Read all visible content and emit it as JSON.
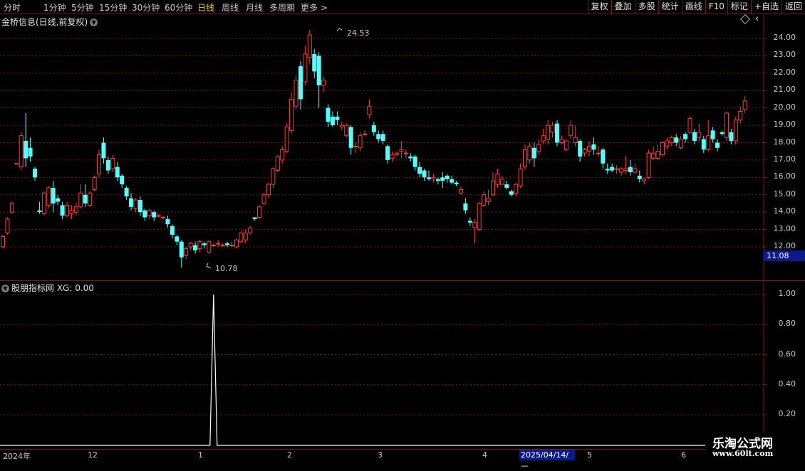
{
  "toolbar": {
    "periods": [
      "分时",
      "1分钟",
      "5分钟",
      "15分钟",
      "30分钟",
      "60分钟",
      "日线",
      "周线",
      "月线",
      "多周期",
      "更多 >"
    ],
    "active": "日线",
    "right_tabs": [
      "复权",
      "叠加",
      "多股",
      "统计",
      "画线",
      "F10",
      "标记",
      "+自选",
      "返回"
    ]
  },
  "chart_title": "金桥信息(日线,前复权)",
  "indicator_title": "股朋指标网  XG: 0.00",
  "price_axis": [
    "24.00",
    "23.00",
    "22.00",
    "21.00",
    "20.00",
    "19.00",
    "18.00",
    "17.00",
    "16.00",
    "15.00",
    "14.00",
    "13.00",
    "12.00"
  ],
  "last_price": "11.08",
  "high_annotation": "24.53",
  "low_annotation": "10.78",
  "indicator_axis": [
    "1.00",
    "0.80",
    "0.60",
    "0.40",
    "0.20"
  ],
  "date_axis": [
    "2024年",
    "12",
    "1",
    "2",
    "3",
    "4",
    "5",
    "6"
  ],
  "date_highlight": "2025/04/14/—",
  "watermark": {
    "title": "乐淘公式网",
    "url": "www.60lt.com"
  },
  "colors": {
    "up": "#ff3c3c",
    "down": "#54ffff",
    "grid": "#7a1a1a",
    "active": "#e6d23c",
    "highlight": "#0b1a8a"
  },
  "chart_data": {
    "type": "candlestick",
    "price_range": [
      11.0,
      24.8
    ],
    "candles": [
      [
        12.0,
        12.6,
        11.9,
        12.7
      ],
      [
        12.8,
        13.6,
        12.7,
        13.7
      ],
      [
        14.0,
        14.5,
        13.9,
        14.6
      ],
      [
        16.8,
        16.8,
        16.8,
        16.8
      ],
      [
        16.6,
        18.4,
        16.4,
        18.6
      ],
      [
        18.1,
        17.1,
        16.6,
        19.7
      ],
      [
        17.7,
        17.2,
        16.9,
        18.3
      ],
      [
        16.5,
        16.0,
        15.8,
        16.6
      ],
      [
        14.1,
        14.0,
        13.9,
        14.6
      ],
      [
        13.9,
        15.1,
        13.8,
        15.2
      ],
      [
        14.4,
        15.4,
        14.2,
        15.5
      ],
      [
        15.4,
        14.5,
        14.0,
        15.8
      ],
      [
        14.8,
        14.6,
        14.4,
        15.0
      ],
      [
        14.4,
        13.8,
        13.6,
        14.6
      ],
      [
        13.8,
        14.4,
        13.7,
        14.6
      ],
      [
        13.9,
        14.1,
        13.6,
        14.4
      ],
      [
        14.0,
        14.3,
        13.8,
        14.5
      ],
      [
        14.3,
        15.1,
        14.2,
        15.6
      ],
      [
        15.0,
        14.5,
        14.3,
        15.6
      ],
      [
        14.4,
        15.1,
        14.3,
        15.2
      ],
      [
        15.3,
        16.0,
        15.2,
        16.1
      ],
      [
        16.2,
        17.3,
        16.0,
        17.6
      ],
      [
        18.0,
        17.1,
        16.8,
        18.3
      ],
      [
        17.0,
        16.4,
        16.2,
        17.2
      ],
      [
        16.5,
        17.1,
        16.3,
        17.3
      ],
      [
        16.6,
        16.0,
        15.8,
        16.9
      ],
      [
        16.1,
        15.6,
        15.4,
        16.2
      ],
      [
        15.4,
        14.9,
        14.7,
        15.5
      ],
      [
        14.8,
        14.3,
        14.1,
        15.1
      ],
      [
        14.2,
        14.7,
        14.0,
        14.8
      ],
      [
        14.7,
        14.0,
        13.8,
        14.9
      ],
      [
        14.1,
        13.7,
        13.5,
        14.2
      ],
      [
        13.8,
        14.1,
        13.6,
        14.2
      ],
      [
        14.0,
        13.7,
        13.5,
        14.1
      ],
      [
        13.8,
        13.8,
        13.7,
        13.9
      ],
      [
        13.7,
        13.7,
        13.6,
        13.8
      ],
      [
        13.6,
        13.3,
        13.1,
        13.8
      ],
      [
        13.2,
        12.7,
        12.5,
        13.3
      ],
      [
        12.6,
        12.3,
        12.1,
        12.7
      ],
      [
        12.3,
        11.4,
        10.8,
        12.4
      ],
      [
        11.5,
        11.9,
        11.3,
        12.0
      ],
      [
        12.0,
        12.2,
        11.8,
        12.3
      ],
      [
        12.1,
        11.8,
        11.6,
        12.3
      ],
      [
        11.9,
        12.3,
        11.7,
        12.4
      ],
      [
        12.2,
        12.1,
        11.9,
        12.3
      ],
      [
        11.7,
        12.3,
        11.6,
        12.4
      ],
      [
        12.1,
        12.1,
        12.0,
        12.2
      ],
      [
        12.2,
        12.2,
        12.0,
        12.4
      ],
      [
        12.1,
        12.1,
        12.0,
        12.2
      ],
      [
        12.2,
        12.1,
        12.0,
        12.3
      ],
      [
        12.1,
        12.1,
        12.0,
        12.3
      ],
      [
        12.0,
        12.4,
        11.9,
        12.5
      ],
      [
        12.3,
        12.8,
        12.2,
        12.9
      ],
      [
        12.4,
        12.8,
        12.2,
        13.0
      ],
      [
        12.8,
        13.1,
        12.7,
        13.2
      ],
      [
        13.7,
        13.6,
        13.5,
        13.7
      ],
      [
        13.7,
        14.3,
        13.6,
        14.4
      ],
      [
        14.5,
        15.0,
        14.4,
        15.1
      ],
      [
        15.0,
        15.6,
        14.8,
        15.7
      ],
      [
        15.6,
        16.5,
        15.4,
        16.6
      ],
      [
        16.4,
        17.2,
        16.3,
        17.3
      ],
      [
        17.0,
        17.6,
        16.8,
        17.8
      ],
      [
        17.5,
        18.9,
        17.4,
        19.1
      ],
      [
        18.7,
        20.5,
        18.5,
        20.9
      ],
      [
        20.1,
        21.6,
        19.9,
        21.9
      ],
      [
        22.4,
        20.5,
        19.9,
        22.7
      ],
      [
        21.5,
        23.1,
        21.3,
        23.6
      ],
      [
        22.9,
        24.2,
        22.5,
        24.5
      ],
      [
        23.1,
        22.1,
        21.7,
        23.4
      ],
      [
        23.0,
        21.3,
        20.0,
        23.2
      ],
      [
        21.3,
        21.6,
        20.9,
        21.8
      ],
      [
        20.0,
        19.2,
        18.9,
        20.2
      ],
      [
        19.5,
        19.0,
        18.9,
        19.8
      ],
      [
        19.5,
        19.3,
        19.0,
        19.8
      ],
      [
        18.9,
        19.0,
        18.7,
        19.2
      ],
      [
        18.4,
        19.0,
        18.3,
        19.1
      ],
      [
        18.9,
        17.7,
        17.3,
        19.0
      ],
      [
        17.8,
        17.8,
        17.4,
        18.0
      ],
      [
        17.7,
        18.4,
        17.5,
        18.6
      ],
      [
        18.5,
        18.5,
        18.4,
        18.7
      ],
      [
        19.6,
        20.1,
        19.4,
        20.5
      ],
      [
        19.0,
        18.6,
        18.4,
        19.2
      ],
      [
        18.5,
        18.2,
        18.0,
        18.7
      ],
      [
        18.5,
        18.1,
        17.9,
        18.7
      ],
      [
        17.8,
        17.0,
        16.8,
        17.9
      ],
      [
        17.1,
        17.3,
        16.9,
        17.5
      ],
      [
        17.3,
        17.4,
        17.2,
        17.5
      ],
      [
        17.5,
        17.6,
        17.1,
        18.1
      ],
      [
        17.4,
        17.4,
        17.1,
        17.6
      ],
      [
        17.2,
        17.1,
        16.9,
        17.4
      ],
      [
        17.2,
        16.6,
        16.4,
        17.3
      ],
      [
        16.6,
        16.2,
        16.0,
        16.9
      ],
      [
        16.4,
        16.0,
        15.8,
        16.5
      ],
      [
        16.0,
        15.9,
        15.8,
        16.4
      ],
      [
        15.9,
        16.0,
        15.7,
        16.2
      ],
      [
        15.9,
        15.8,
        15.6,
        16.0
      ],
      [
        16.0,
        15.8,
        15.4,
        16.3
      ],
      [
        16.1,
        15.9,
        15.7,
        16.2
      ],
      [
        15.9,
        15.7,
        15.6,
        16.1
      ],
      [
        15.7,
        15.6,
        15.5,
        15.8
      ],
      [
        15.1,
        15.3,
        15.0,
        15.5
      ],
      [
        14.5,
        14.1,
        13.9,
        14.8
      ],
      [
        13.5,
        13.4,
        13.2,
        13.7
      ],
      [
        13.1,
        13.4,
        12.2,
        13.6
      ],
      [
        13.0,
        14.5,
        12.9,
        14.6
      ],
      [
        14.4,
        15.0,
        14.3,
        15.2
      ],
      [
        14.6,
        14.8,
        14.4,
        15.3
      ],
      [
        15.0,
        15.8,
        14.9,
        16.3
      ],
      [
        15.6,
        16.2,
        15.4,
        16.5
      ],
      [
        15.6,
        15.9,
        15.6,
        16.1
      ],
      [
        15.6,
        15.4,
        15.3,
        15.8
      ],
      [
        15.2,
        15.0,
        14.9,
        15.3
      ],
      [
        15.1,
        15.6,
        14.9,
        15.7
      ],
      [
        15.5,
        16.5,
        15.4,
        16.8
      ],
      [
        16.6,
        17.6,
        16.4,
        17.9
      ],
      [
        17.0,
        17.8,
        16.8,
        18.0
      ],
      [
        17.7,
        17.1,
        16.6,
        18.0
      ],
      [
        17.5,
        17.9,
        17.3,
        18.2
      ],
      [
        18.1,
        18.4,
        17.9,
        18.8
      ],
      [
        18.2,
        19.0,
        17.9,
        19.3
      ],
      [
        18.6,
        19.0,
        18.3,
        19.2
      ],
      [
        19.1,
        18.0,
        17.8,
        19.3
      ],
      [
        18.0,
        18.2,
        17.9,
        18.4
      ],
      [
        17.6,
        18.1,
        17.5,
        18.2
      ],
      [
        18.4,
        19.0,
        18.2,
        19.3
      ],
      [
        18.0,
        18.3,
        17.8,
        19.0
      ],
      [
        18.1,
        17.2,
        16.9,
        18.2
      ],
      [
        17.4,
        17.6,
        17.2,
        17.7
      ],
      [
        17.5,
        17.8,
        17.2,
        18.1
      ],
      [
        17.9,
        17.6,
        17.3,
        18.3
      ],
      [
        17.4,
        17.4,
        17.2,
        17.8
      ],
      [
        17.6,
        16.8,
        16.5,
        17.7
      ],
      [
        16.5,
        16.4,
        16.2,
        16.8
      ],
      [
        16.6,
        16.4,
        16.3,
        16.8
      ],
      [
        16.5,
        16.5,
        16.2,
        16.7
      ],
      [
        16.3,
        16.5,
        16.1,
        16.6
      ],
      [
        16.4,
        16.5,
        16.2,
        17.2
      ],
      [
        16.6,
        16.3,
        16.1,
        17.0
      ],
      [
        16.3,
        16.5,
        16.2,
        16.8
      ],
      [
        16.1,
        15.9,
        15.7,
        16.4
      ],
      [
        15.8,
        15.9,
        15.6,
        16.0
      ],
      [
        16.0,
        17.4,
        15.9,
        17.6
      ],
      [
        17.1,
        17.4,
        17.0,
        17.8
      ],
      [
        17.1,
        17.5,
        17.0,
        17.9
      ],
      [
        17.3,
        18.0,
        17.2,
        18.1
      ],
      [
        17.8,
        18.1,
        17.6,
        18.3
      ],
      [
        18.0,
        18.3,
        17.8,
        18.4
      ],
      [
        18.3,
        18.0,
        17.8,
        18.5
      ],
      [
        17.7,
        18.2,
        17.6,
        18.4
      ],
      [
        18.5,
        18.2,
        18.0,
        18.6
      ],
      [
        18.6,
        19.4,
        18.5,
        19.5
      ],
      [
        18.6,
        18.1,
        17.9,
        18.8
      ],
      [
        18.3,
        18.6,
        18.1,
        19.1
      ],
      [
        18.2,
        17.6,
        17.4,
        18.4
      ],
      [
        17.6,
        18.4,
        17.5,
        19.3
      ],
      [
        18.7,
        18.2,
        18.0,
        18.9
      ],
      [
        18.0,
        17.7,
        17.5,
        18.2
      ],
      [
        18.6,
        18.5,
        18.4,
        18.7
      ],
      [
        18.3,
        19.7,
        18.1,
        19.8
      ],
      [
        18.6,
        18.1,
        17.9,
        18.8
      ],
      [
        18.1,
        19.3,
        17.9,
        19.5
      ],
      [
        19.3,
        19.8,
        19.1,
        20.1
      ],
      [
        19.9,
        20.4,
        19.7,
        20.7
      ]
    ],
    "indicator": {
      "name": "XG",
      "spike_index": 39,
      "spike_value": 1.0,
      "ylim": [
        0,
        1.0
      ]
    }
  }
}
